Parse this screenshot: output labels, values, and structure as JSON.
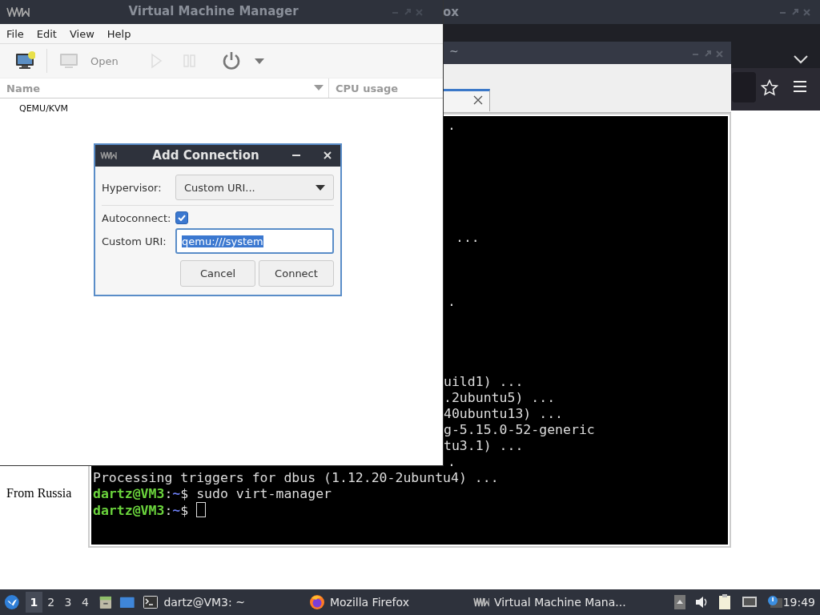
{
  "firefox": {
    "title": "ox",
    "page_text": "From Russia"
  },
  "terminal": {
    "title": "~",
    "lines": [
      {
        "kind": "output",
        "text": "."
      },
      {
        "kind": "output",
        "text": "..."
      },
      {
        "kind": "output",
        "text": "."
      },
      {
        "kind": "output",
        "text": "uild1) ..."
      },
      {
        "kind": "output",
        "text": ".2ubuntu5) ..."
      },
      {
        "kind": "output",
        "text": "40ubuntu13) ..."
      },
      {
        "kind": "output",
        "text": "g-5.15.0-52-generic"
      },
      {
        "kind": "output",
        "text": "tu3.1) ..."
      },
      {
        "kind": "output",
        "text": "."
      },
      {
        "kind": "output",
        "text": "Processing triggers for dbus (1.12.20-2ubuntu4) ..."
      },
      {
        "kind": "prompt",
        "user": "dartz@VM3",
        "sep": ":",
        "path": "~",
        "command": "$ sudo virt-manager"
      },
      {
        "kind": "prompt",
        "user": "dartz@VM3",
        "sep": ":",
        "path": "~",
        "command": "$",
        "cursor": true
      }
    ]
  },
  "vmm": {
    "title": "Virtual Machine Manager",
    "menu": [
      "File",
      "Edit",
      "View",
      "Help"
    ],
    "toolbar": [
      {
        "kind": "new",
        "disabled": false
      },
      {
        "kind": "open",
        "label": "Open",
        "disabled": true
      },
      {
        "kind": "run",
        "disabled": true
      },
      {
        "kind": "pause",
        "disabled": true
      },
      {
        "kind": "power",
        "disabled": false
      },
      {
        "kind": "menu",
        "disabled": false
      }
    ],
    "columns": [
      "Name",
      "CPU usage"
    ],
    "rows": [
      "QEMU/KVM"
    ]
  },
  "dialog": {
    "title": "Add Connection",
    "hypervisor_label": "Hypervisor:",
    "hypervisor_value": "Custom URI...",
    "autoconnect_label": "Autoconnect:",
    "autoconnect_checked": true,
    "uri_label": "Custom URI:",
    "uri_value": "qemu:///system",
    "uri_text_selected": true,
    "buttons": [
      "Cancel",
      "Connect"
    ]
  },
  "taskbar": {
    "workspaces": [
      {
        "label": "1",
        "selected": true
      },
      {
        "label": "2",
        "selected": false
      },
      {
        "label": "3",
        "selected": false
      },
      {
        "label": "4",
        "selected": false
      }
    ],
    "tasks": [
      {
        "kind": "terminal",
        "label": "dartz@VM3: ~"
      },
      {
        "kind": "firefox",
        "label": "Mozilla Firefox"
      },
      {
        "kind": "vmm",
        "label": "Virtual Machine Mana..."
      }
    ],
    "clock": "19:49"
  }
}
